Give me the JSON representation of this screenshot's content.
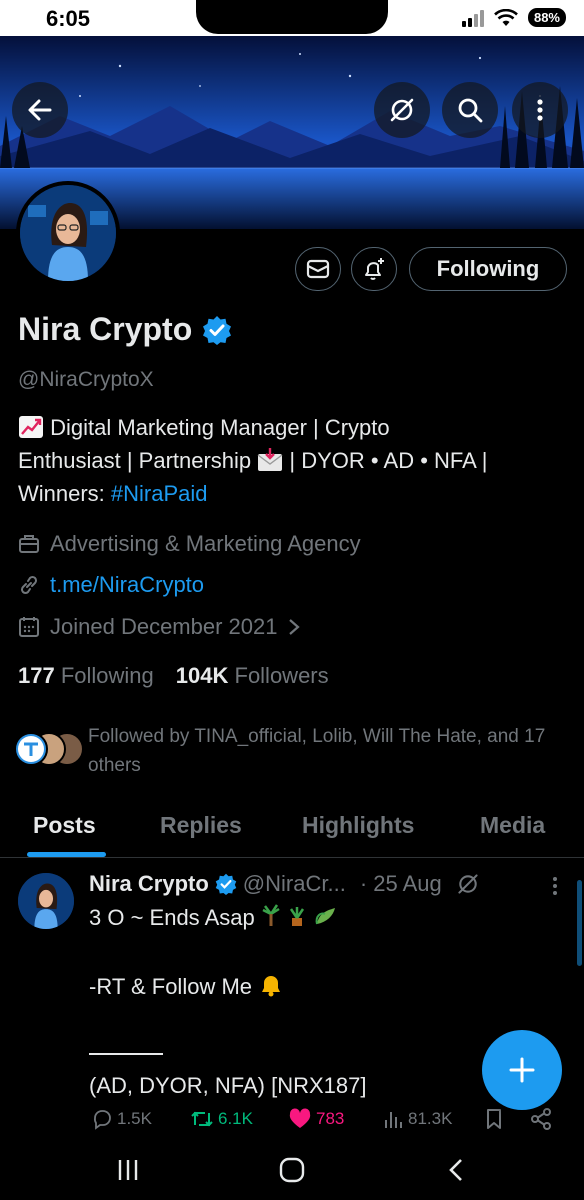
{
  "status_bar": {
    "time": "6:05",
    "battery": "88%"
  },
  "profile": {
    "name": "Nira Crypto",
    "handle": "@NiraCryptoX",
    "bio": {
      "line1": "Digital Marketing Manager | Crypto",
      "line2a": "Enthusiast  | Partnership",
      "line2b": "| DYOR • AD • NFA |",
      "line3a": "Winners:",
      "hashtag": "#NiraPaid"
    },
    "category": "Advertising & Marketing Agency",
    "link": "t.me/NiraCrypto",
    "joined": "Joined December 2021",
    "following_count": "177",
    "following_label": "Following",
    "followers_count": "104K",
    "followers_label": "Followers",
    "followed_by": "Followed by TINA_official, Lolib, Will The Hate, and 17 others"
  },
  "actions": {
    "following_button": "Following"
  },
  "tabs": [
    "Posts",
    "Replies",
    "Highlights",
    "Media"
  ],
  "post": {
    "name": "Nira Crypto",
    "handle": "@NiraCr...",
    "date": "· 25 Aug",
    "lines": [
      "3 O ~ Ends Asap",
      "",
      "-RT & Follow Me",
      "",
      "",
      "(AD, DYOR, NFA) [NRX187]"
    ],
    "replies": "1.5K",
    "reposts": "6.1K",
    "likes": "783",
    "views": "81.3K"
  },
  "colors": {
    "accent": "#1d9bf0",
    "like": "#f91880",
    "repost": "#00ba7c",
    "muted": "#71767b"
  }
}
